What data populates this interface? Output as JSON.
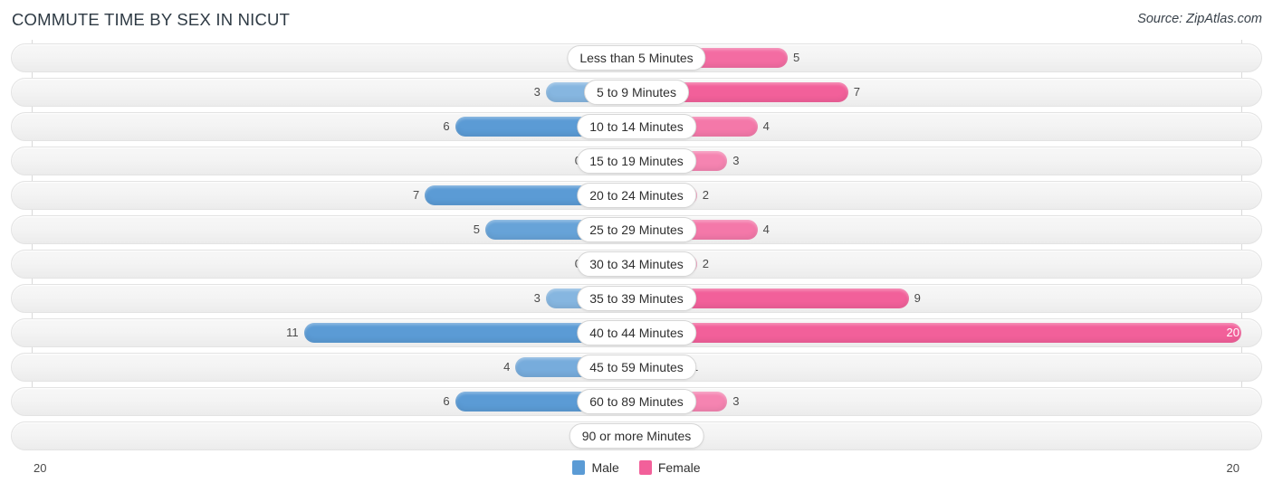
{
  "header": {
    "title": "COMMUTE TIME BY SEX IN NICUT",
    "source": "Source: ZipAtlas.com"
  },
  "legend": {
    "male_label": "Male",
    "female_label": "Female",
    "male_color": "#5b9bd5",
    "female_color": "#f2609a"
  },
  "axis": {
    "left_label": "20",
    "right_label": "20"
  },
  "chart_data": {
    "type": "bar",
    "title": "COMMUTE TIME BY SEX IN NICUT",
    "subtitle": "",
    "xlabel": "",
    "ylabel": "",
    "orientation": "horizontal-diverging",
    "axis_max": 20,
    "xlim": [
      20,
      20
    ],
    "grid": true,
    "legend_position": "bottom-center",
    "categories": [
      "Less than 5 Minutes",
      "5 to 9 Minutes",
      "10 to 14 Minutes",
      "15 to 19 Minutes",
      "20 to 24 Minutes",
      "25 to 29 Minutes",
      "30 to 34 Minutes",
      "35 to 39 Minutes",
      "40 to 44 Minutes",
      "45 to 59 Minutes",
      "60 to 89 Minutes",
      "90 or more Minutes"
    ],
    "series": [
      {
        "name": "Male",
        "color": "#5b9bd5",
        "values": [
          0,
          3,
          6,
          0,
          7,
          5,
          0,
          3,
          11,
          4,
          6,
          0
        ]
      },
      {
        "name": "Female",
        "color": "#f2609a",
        "values": [
          5,
          7,
          4,
          3,
          2,
          4,
          2,
          9,
          20,
          1,
          3,
          0
        ]
      }
    ]
  }
}
